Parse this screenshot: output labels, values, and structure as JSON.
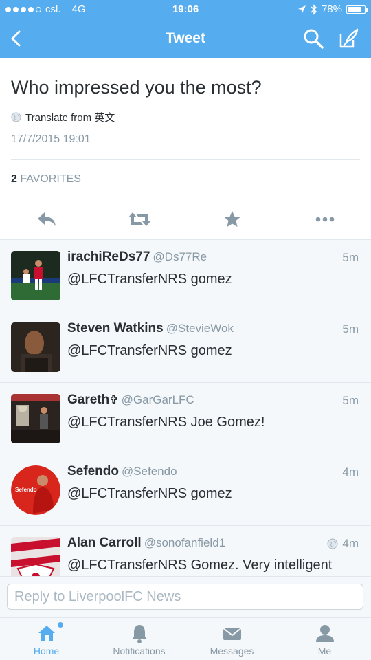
{
  "status_bar": {
    "carrier": "csl.",
    "network": "4G",
    "time": "19:06",
    "battery_percent_label": "78%",
    "battery_level": 0.78
  },
  "nav": {
    "title": "Tweet"
  },
  "tweet": {
    "text": "Who impressed you the most?",
    "translate_label": "Translate from 英文",
    "timestamp": "17/7/2015 19:01",
    "favorites_count": "2",
    "favorites_label": "FAVORITES"
  },
  "replies": [
    {
      "name": "irachiReDs77",
      "handle": "@Ds77Re",
      "time": "5m",
      "text": "@LFCTransferNRS gomez"
    },
    {
      "name": "Steven Watkins",
      "handle": "@StevieWok",
      "time": "5m",
      "text": "@LFCTransferNRS gomez"
    },
    {
      "name": "Gareth",
      "name_symbol": "✞",
      "handle": "@GarGarLFC",
      "time": "5m",
      "text": "@LFCTransferNRS Joe Gomez!"
    },
    {
      "name": "Sefendo",
      "handle": "@Sefendo",
      "time": "4m",
      "text": "@LFCTransferNRS gomez",
      "avatar_text": "Sefendo"
    },
    {
      "name": "Alan Carroll",
      "handle": "@sonofanfield1",
      "time": "4m",
      "text": "@LFCTransferNRS Gomez. Very intelligent"
    }
  ],
  "reply_bar": {
    "placeholder": "Reply to LiverpoolFC News"
  },
  "tabs": [
    {
      "label": "Home",
      "icon": "home-icon",
      "active": true
    },
    {
      "label": "Notifications",
      "icon": "bell-icon",
      "active": false
    },
    {
      "label": "Messages",
      "icon": "envelope-icon",
      "active": false
    },
    {
      "label": "Me",
      "icon": "person-icon",
      "active": false
    }
  ],
  "colors": {
    "brand_blue": "#55acee",
    "text_dark": "#292f33",
    "text_gray": "#8899a6",
    "divider": "#e1e8ed",
    "reply_bg": "#f5f8fa"
  }
}
